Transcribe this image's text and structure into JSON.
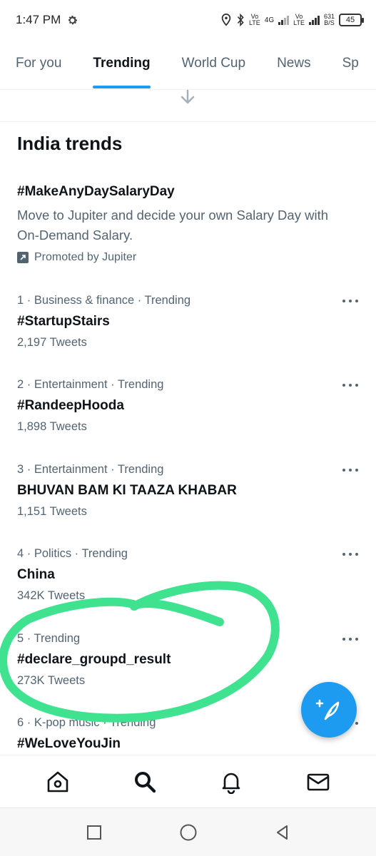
{
  "status_bar": {
    "time": "1:47 PM",
    "settings_icon": "gear-icon",
    "volte1": [
      "Vo",
      "LTE"
    ],
    "network": "4G",
    "volte2": [
      "Vo",
      "LTE"
    ],
    "speed": [
      "631",
      "B/S"
    ],
    "battery": "45"
  },
  "tabs": [
    {
      "label": "For you",
      "active": false
    },
    {
      "label": "Trending",
      "active": true
    },
    {
      "label": "World Cup",
      "active": false
    },
    {
      "label": "News",
      "active": false
    },
    {
      "label": "Sp",
      "active": false
    }
  ],
  "section_title": "India trends",
  "promoted": {
    "tag": "#MakeAnyDaySalaryDay",
    "description": "Move to Jupiter and decide your own Salary Day with On-Demand Salary.",
    "by": "Promoted by Jupiter"
  },
  "trends": [
    {
      "meta": "1 · Business & finance · Trending",
      "name": "#StartupStairs",
      "count": "2,197 Tweets"
    },
    {
      "meta": "2 · Entertainment · Trending",
      "name": "#RandeepHooda",
      "count": "1,898 Tweets"
    },
    {
      "meta": "3 · Entertainment · Trending",
      "name": "BHUVAN BAM KI TAAZA KHABAR",
      "count": "1,151 Tweets"
    },
    {
      "meta": "4 · Politics · Trending",
      "name": "China",
      "count": "342K Tweets"
    },
    {
      "meta": "5 · Trending",
      "name": "#declare_groupd_result",
      "count": "273K Tweets"
    },
    {
      "meta": "6 · K-pop music · Trending",
      "name": "#WeLoveYouJin",
      "count": ""
    }
  ],
  "colors": {
    "accent": "#1d9bf0",
    "highlight": "#3ee28f"
  },
  "bottom_nav": [
    "home-icon",
    "search-icon",
    "notifications-icon",
    "messages-icon"
  ],
  "system_nav": [
    "recents-icon",
    "home-circle-icon",
    "back-icon"
  ]
}
